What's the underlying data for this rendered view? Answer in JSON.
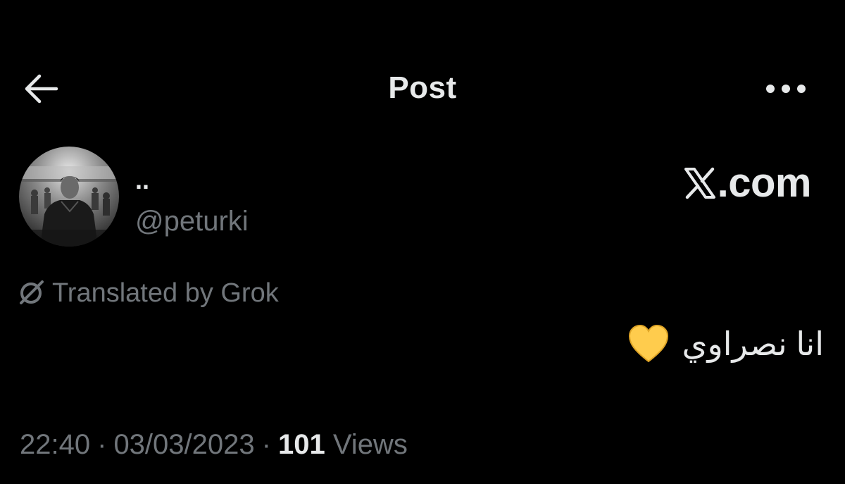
{
  "header": {
    "back_icon": "arrow-left-icon",
    "title": "Post",
    "more_icon": "more-horizontal-icon"
  },
  "author": {
    "display_name": "..",
    "handle": "@peturki",
    "avatar_icon": "profile-photo-grayscale"
  },
  "watermark": {
    "text": ".com",
    "logo_icon": "x-logo-icon"
  },
  "translation": {
    "icon": "grok-icon",
    "label": "Translated by Grok"
  },
  "post": {
    "text": "انا نصراوي",
    "emoji_icon": "yellow-heart-icon"
  },
  "meta": {
    "time": "22:40",
    "date": "03/03/2023",
    "separator": "·",
    "views_count": "101",
    "views_label": "Views"
  },
  "colors": {
    "background": "#000000",
    "primary_text": "#e7e9ea",
    "secondary_text": "#71767b",
    "heart": "#ffcc4d"
  }
}
